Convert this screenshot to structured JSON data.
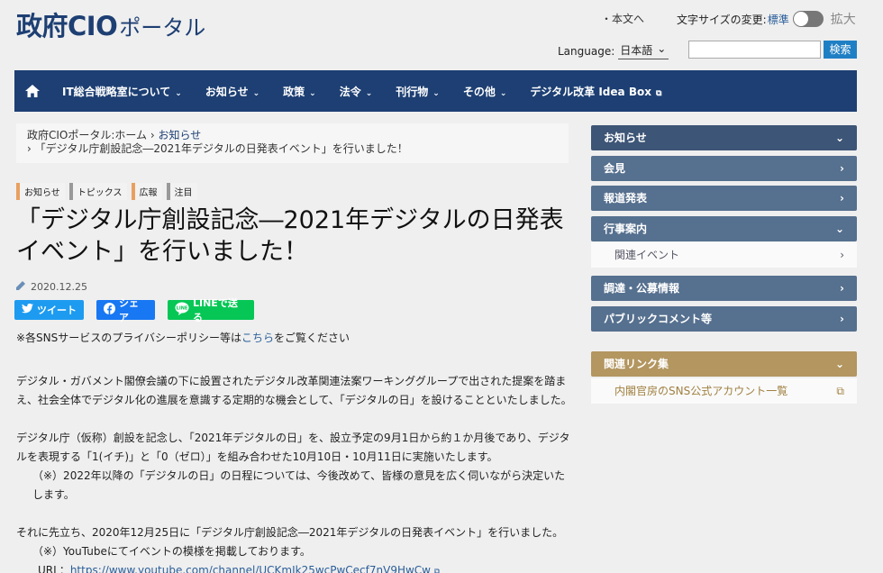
{
  "header": {
    "logo_main": "政府CIO",
    "logo_sub": "ポータル",
    "skip_link": "・本文へ",
    "font_size_label": "文字サイズの変更:",
    "font_size_std": "標準",
    "font_size_big": "拡大",
    "language_label": "Language:",
    "language_value": "日本語",
    "search_button": "検索",
    "search_placeholder": ""
  },
  "nav": {
    "items": [
      {
        "label": "IT総合戦略室について",
        "caret": true
      },
      {
        "label": "お知らせ",
        "caret": true
      },
      {
        "label": "政策",
        "caret": true
      },
      {
        "label": "法令",
        "caret": true
      },
      {
        "label": "刊行物",
        "caret": true
      },
      {
        "label": "その他",
        "caret": true
      },
      {
        "label": "デジタル改革 Idea Box",
        "caret": false
      }
    ]
  },
  "breadcrumb": {
    "home": "政府CIOポータル:ホーム",
    "sep": "›",
    "section": "お知らせ",
    "current": "「デジタル庁創設記念―2021年デジタルの日発表イベント」を行いました！"
  },
  "article": {
    "tags": [
      "お知らせ",
      "トピックス",
      "広報",
      "注目"
    ],
    "title": "「デジタル庁創設記念―2021年デジタルの日発表イベント」を行いました！",
    "date": "2020.12.25",
    "share": {
      "twitter": "ツイート",
      "facebook": "シェア",
      "line": "LINEで送る"
    },
    "sns_note_prefix": "※各SNSサービスのプライバシーポリシー等は",
    "sns_note_link": "こちら",
    "sns_note_suffix": "をご覧ください",
    "p1": "デジタル・ガバメント閣僚会議の下に設置されたデジタル改革関連法案ワーキンググループで出された提案を踏まえ、社会全体でデジタル化の進展を意識する定期的な機会として、「デジタルの日」を設けることといたしました。",
    "p2": "デジタル庁（仮称）創設を記念し、「2021年デジタルの日」を、設立予定の9月1日から約１か月後であり、デジタルを表現する「1(イチ)」と「0（ゼロ）」を組み合わせた10月10日・10月11日に実施いたします。",
    "p2_note": "（※）2022年以降の「デジタルの日」の日程については、今後改めて、皆様の意見を広く伺いながら決定いたします。",
    "p3": "それに先立ち、2020年12月25日に「デジタル庁創設記念―2021年デジタルの日発表イベント」を行いました。",
    "p3_note": "（※）YouTubeにてイベントの模様を掲載しております。",
    "url_label": "URL：",
    "url": "https://www.youtube.com/channel/UCKmJk25wcPwCecf7nV9HwCw"
  },
  "sidebar": {
    "news": "お知らせ",
    "press_conf": "会見",
    "press_release": "報道発表",
    "events": "行事案内",
    "related_events": "関連イベント",
    "procurement": "調達・公募情報",
    "public_comment": "パブリックコメント等",
    "links_title": "関連リンク集",
    "links_item": "内閣官房のSNS公式アカウント一覧"
  }
}
